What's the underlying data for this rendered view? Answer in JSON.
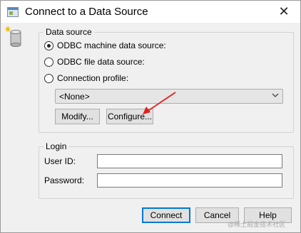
{
  "window": {
    "title": "Connect to a Data Source",
    "close_symbol": "✕"
  },
  "data_source": {
    "group_label": "Data source",
    "options": [
      {
        "label": "ODBC machine data source:",
        "checked": true
      },
      {
        "label": "ODBC file data source:",
        "checked": false
      },
      {
        "label": "Connection profile:",
        "checked": false
      }
    ],
    "profile_select": {
      "value": "<None>"
    },
    "modify_label": "Modify...",
    "configure_label": "Configure..."
  },
  "login": {
    "group_label": "Login",
    "user_id_label": "User ID:",
    "user_id_value": "",
    "password_label": "Password:",
    "password_value": ""
  },
  "buttons": {
    "connect": "Connect",
    "cancel": "Cancel",
    "help": "Help"
  },
  "watermark": "@稀土掘金技术社区",
  "colors": {
    "annotation_arrow": "#e02020",
    "default_button_border": "#0078d7"
  }
}
